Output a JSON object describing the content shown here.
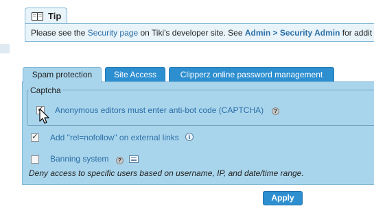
{
  "tip": {
    "title": "Tip",
    "text_prefix": "Please see the ",
    "security_page_link": "Security page",
    "text_middle": " on Tiki's developer site. See ",
    "admin_link": "Admin > Security Admin",
    "text_suffix": " for addit"
  },
  "tabs": [
    {
      "label": "Spam protection",
      "active": true
    },
    {
      "label": "Site Access",
      "active": false
    },
    {
      "label": "Clipperz online password management",
      "active": false
    }
  ],
  "captcha": {
    "legend": "Captcha",
    "option_label": "Anonymous editors must enter anti-bot code (CAPTCHA)",
    "checked": true
  },
  "nofollow": {
    "label": "Add \"rel=nofollow\" on external links",
    "checked": true
  },
  "banning": {
    "label": "Banning system",
    "checked": false,
    "description": "Deny access to specific users based on username, IP, and date/time range."
  },
  "apply_label": "Apply",
  "colors": {
    "panel_bg": "#a9d5ec",
    "tab_inactive": "#2e8fd0",
    "link": "#2b6fa8",
    "tip_bg": "#e8f3fa"
  }
}
